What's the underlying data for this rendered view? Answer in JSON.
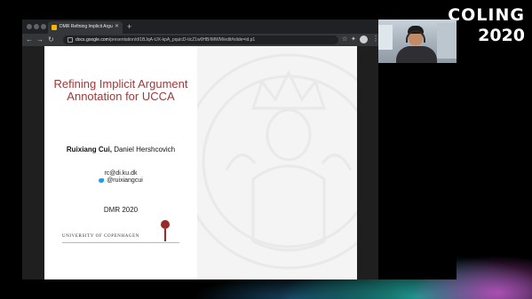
{
  "event": {
    "name": "COLING",
    "year": "2020"
  },
  "browser": {
    "tab_title": "DMR Refining Implicit Argume...",
    "new_tab_symbol": "+",
    "url_host": "docs.google.com",
    "url_path": "/presentation/d/1BJqA-tJX-kpA_pquicD-ticZ1w0HB/iMWM/edit#slide=id.p1"
  },
  "slide": {
    "title": "Refining Implicit Argument Annotation for UCCA",
    "author_primary": "Ruixiang Cui,",
    "author_secondary": " Daniel Hershcovich",
    "email": "rc@di.ku.dk",
    "twitter_handle": "@ruixiangcui",
    "venue": "DMR 2020",
    "university": "UNIVERSITY OF COPENHAGEN"
  },
  "colors": {
    "title_red": "#9a3a3a",
    "glow_pink": "#c850c8",
    "glow_teal": "#28c8be"
  },
  "icons": {
    "favicon": "google-slides-icon",
    "back": "back-arrow-icon",
    "forward": "forward-arrow-icon",
    "reload": "reload-icon",
    "lock": "lock-icon",
    "star": "star-icon",
    "extensions": "puzzle-icon",
    "menu": "kebab-menu-icon",
    "twitter": "twitter-icon"
  }
}
